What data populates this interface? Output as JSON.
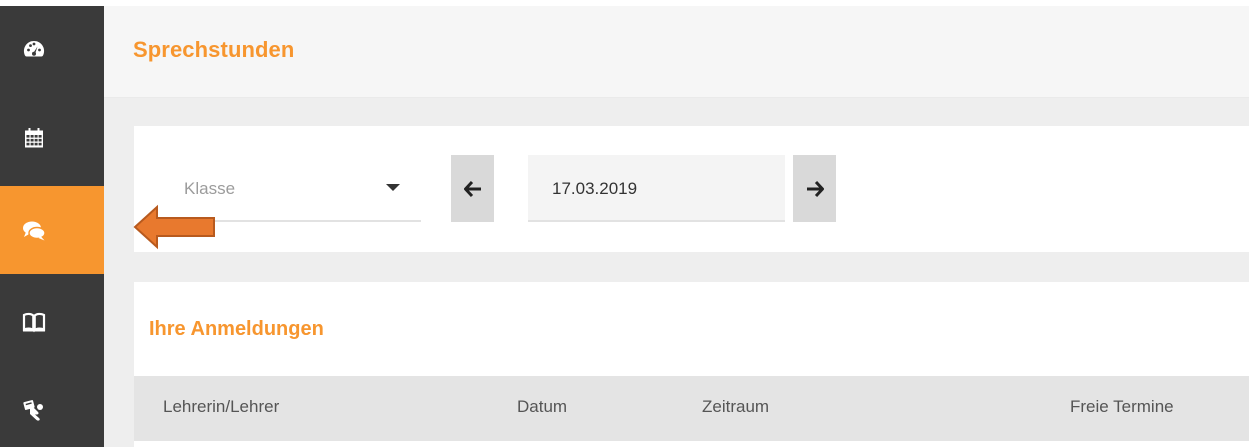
{
  "sidebar": {
    "items": [
      {
        "icon": "dashboard-icon",
        "active": false
      },
      {
        "icon": "calendar-icon",
        "active": false
      },
      {
        "icon": "chat-icon",
        "active": true
      },
      {
        "icon": "book-icon",
        "active": false
      },
      {
        "icon": "contact-card-icon",
        "active": false
      }
    ],
    "colors": {
      "background": "#3a3a3a",
      "active": "#f7962f"
    }
  },
  "header": {
    "title": "Sprechstunden"
  },
  "filters": {
    "class_select": {
      "placeholder": "Klasse"
    },
    "date": {
      "value": "17.03.2019"
    }
  },
  "registrations": {
    "title": "Ihre Anmeldungen",
    "columns": [
      "Lehrerin/Lehrer",
      "Datum",
      "Zeitraum",
      "Freie Termine"
    ]
  },
  "colors": {
    "accent": "#f7962f"
  }
}
